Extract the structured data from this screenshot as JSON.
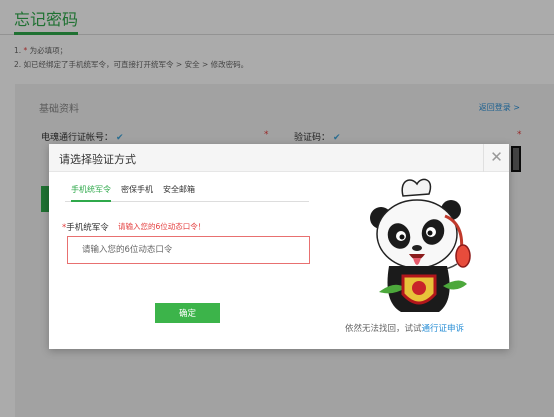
{
  "page": {
    "title": "忘记密码",
    "notes": [
      {
        "prefix": "1. ",
        "req": "*",
        "text": " 为必填项；"
      },
      {
        "prefix": "2. ",
        "req": "",
        "text": "如已经绑定了手机统军令，可直接打开统军令 > 安全 > 修改密码。"
      }
    ]
  },
  "panel": {
    "heading": "基础资料",
    "back_link": "返回登录 >",
    "account_label": "电魂通行证帐号：",
    "captcha_label": "验证码：",
    "check_glyph": "✔",
    "required_mark": "*"
  },
  "modal": {
    "title": "请选择验证方式",
    "close_glyph": "✕",
    "tabs": [
      {
        "label": "手机统军令",
        "active": true
      },
      {
        "label": "密保手机",
        "active": false
      },
      {
        "label": "安全邮箱",
        "active": false
      }
    ],
    "field": {
      "required_mark": "*",
      "label": "手机统军令",
      "error": "请输入您的6位动态口令！",
      "placeholder": "请输入您的6位动态口令"
    },
    "confirm_label": "确定",
    "footer_text": "依然无法找回，试试",
    "footer_link": "通行证申诉",
    "mascot_icon": "panda-mascot-with-headset"
  },
  "colors": {
    "brand_green": "#2fa94b",
    "error_red": "#e43d3d",
    "link_blue": "#2a8fd6"
  }
}
